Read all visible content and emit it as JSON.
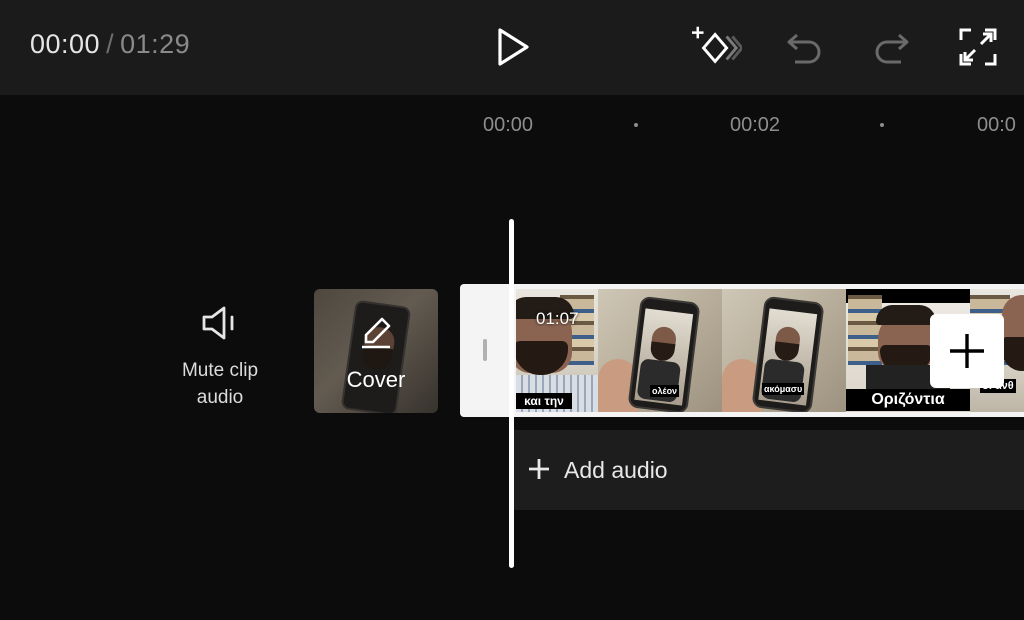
{
  "toolbar": {
    "current_time": "00:00",
    "separator": "/",
    "total_time": "01:29",
    "buttons": {
      "play": "play-icon",
      "keyframe": "keyframe-add-icon",
      "undo": "undo-icon",
      "redo": "redo-icon",
      "fullscreen": "fullscreen-icon"
    }
  },
  "ruler": {
    "labels": [
      "00:00",
      "00:02",
      "00:0"
    ]
  },
  "mute": {
    "label_line1": "Mute clip",
    "label_line2": "audio"
  },
  "cover": {
    "label": "Cover"
  },
  "clip": {
    "frame_time": "01:07",
    "captions": [
      "και την",
      "ολέον",
      "ακόμασυ",
      "Οριζόντια",
      "οι άνθ"
    ]
  },
  "audio": {
    "label": "Add audio"
  },
  "colors": {
    "background": "#0c0c0c",
    "toolbar": "#1b1b1b",
    "accent": "#ffffff",
    "muted_text": "#8d8d8d"
  }
}
